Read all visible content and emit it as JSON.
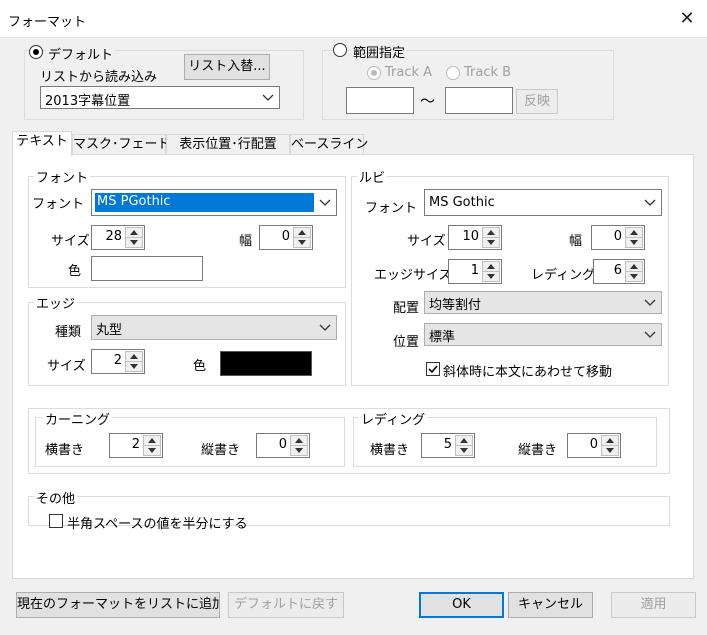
{
  "window": {
    "title": "フォーマット",
    "close_glyph": "✕"
  },
  "source": {
    "default_radio": "デフォルト",
    "list_label": "リストから読み込み",
    "swap_button": "リスト入替...",
    "preset_value": "2013字幕位置",
    "range_radio": "範囲指定",
    "track_a": "Track A",
    "track_b": "Track B",
    "tilde": "〜",
    "apply_range_button": "反映"
  },
  "tabs": [
    {
      "label": "テキスト"
    },
    {
      "label": "マスク･フェード"
    },
    {
      "label": "表示位置･行配置"
    },
    {
      "label": "ベースライン"
    }
  ],
  "font_group": {
    "title": "フォント",
    "font_label": "フォント",
    "font_value": "MS PGothic",
    "size_label": "サイズ",
    "size_value": "28",
    "width_label": "幅",
    "width_value": "0",
    "color_label": "色"
  },
  "edge_group": {
    "title": "エッジ",
    "type_label": "種類",
    "type_value": "丸型",
    "size_label": "サイズ",
    "size_value": "2",
    "color_label": "色"
  },
  "ruby_group": {
    "title": "ルビ",
    "font_label": "フォント",
    "font_value": "MS Gothic",
    "size_label": "サイズ",
    "size_value": "10",
    "width_label": "幅",
    "width_value": "0",
    "edge_size_label": "エッジサイズ",
    "edge_size_value": "1",
    "leading_label": "レディング",
    "leading_value": "6",
    "align_label": "配置",
    "align_value": "均等割付",
    "position_label": "位置",
    "position_value": "標準",
    "italic_check_label": "斜体時に本文にあわせて移動",
    "italic_checked": true
  },
  "kerning_group": {
    "title": "カーニング",
    "horizontal_label": "横書き",
    "horizontal_value": "2",
    "vertical_label": "縦書き",
    "vertical_value": "0"
  },
  "leading_group": {
    "title": "レディング",
    "horizontal_label": "横書き",
    "horizontal_value": "5",
    "vertical_label": "縦書き",
    "vertical_value": "0"
  },
  "other_group": {
    "title": "その他",
    "halfspace_label": "半角スペースの値を半分にする",
    "halfspace_checked": false
  },
  "footer": {
    "add_to_list": "現在のフォーマットをリストに追加",
    "reset_default": "デフォルトに戻す",
    "ok": "OK",
    "cancel": "キャンセル",
    "apply": "適用"
  },
  "colors": {
    "selection": "#0078d7",
    "font_color": "#ffffff",
    "edge_color": "#000000"
  }
}
